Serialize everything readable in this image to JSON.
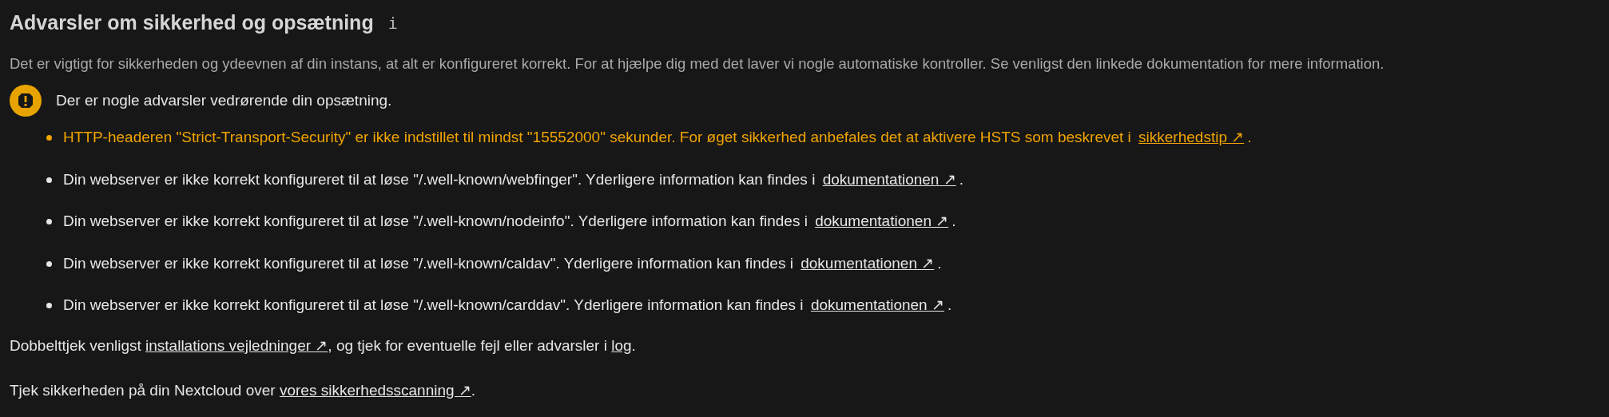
{
  "heading": {
    "title": "Advarsler om sikkerhed og opsætning",
    "info_icon": "i"
  },
  "description": "Det er vigtigt for sikkerheden og ydeevnen af din instans, at alt er konfigureret korrekt. For at hjælpe dig med det laver vi nogle automatiske kontroller. Se venligst den linkede dokumentation for mere information.",
  "summary": {
    "kind": "warning",
    "text": "Der er nogle advarsler vedrørende din opsætning."
  },
  "checks": [
    {
      "kind": "warning",
      "text": "HTTP-headeren \"Strict-Transport-Security\" er ikke indstillet til mindst \"15552000\" sekunder. For øget sikkerhed anbefales det at aktivere HSTS som beskrevet i",
      "link": "sikkerhedstip ↗",
      "end": "."
    },
    {
      "kind": "info",
      "text": "Din webserver er ikke korrekt konfigureret til at løse \"/.well-known/webfinger\". Yderligere information kan findes i",
      "link": "dokumentationen ↗",
      "end": "."
    },
    {
      "kind": "info",
      "text": "Din webserver er ikke korrekt konfigureret til at løse \"/.well-known/nodeinfo\". Yderligere information kan findes i",
      "link": "dokumentationen ↗",
      "end": "."
    },
    {
      "kind": "info",
      "text": "Din webserver er ikke korrekt konfigureret til at løse \"/.well-known/caldav\". Yderligere information kan findes i",
      "link": "dokumentationen ↗",
      "end": "."
    },
    {
      "kind": "info",
      "text": "Din webserver er ikke korrekt konfigureret til at løse \"/.well-known/carddav\". Yderligere information kan findes i",
      "link": "dokumentationen ↗",
      "end": "."
    }
  ],
  "footer": [
    {
      "parts": [
        {
          "text": "Dobbelttjek venligst "
        },
        {
          "link": "installations vejledninger ↗"
        },
        {
          "text": ", og tjek for eventuelle fejl eller advarsler i "
        },
        {
          "link": "log"
        },
        {
          "text": "."
        }
      ]
    },
    {
      "parts": [
        {
          "text": "Tjek sikkerheden på din Nextcloud over "
        },
        {
          "link": "vores sikkerhedsscanning ↗"
        },
        {
          "text": "."
        }
      ]
    }
  ]
}
